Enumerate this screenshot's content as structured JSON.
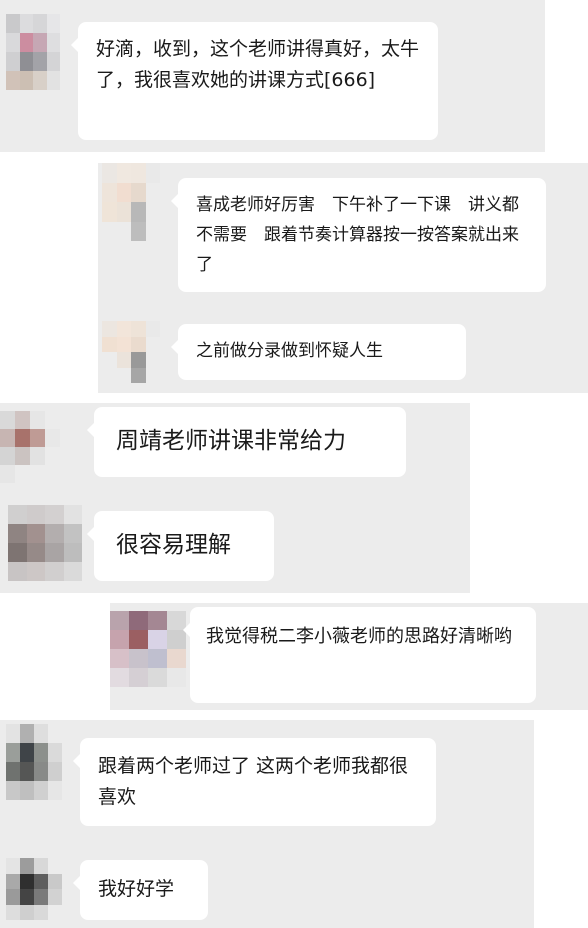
{
  "chat": {
    "messages": [
      {
        "text": "好滴，收到，这个老师讲得真好，太牛了，我很喜欢她的讲课方式[666]"
      },
      {
        "text": "喜成老师好厉害　下午补了一下课　讲义都不需要　跟着节奏计算器按一按答案就出来了"
      },
      {
        "text": "之前做分录做到怀疑人生"
      },
      {
        "text": "周靖老师讲课非常给力"
      },
      {
        "text": "很容易理解"
      },
      {
        "text": "我觉得税二李小薇老师的思路好清晰哟"
      },
      {
        "text": "跟着两个老师过了 这两个老师我都很喜欢"
      },
      {
        "text": "我好好学"
      }
    ]
  },
  "colors": {
    "panel_background": "#ececec",
    "bubble_background": "#ffffff",
    "text": "#1a1a1a"
  }
}
